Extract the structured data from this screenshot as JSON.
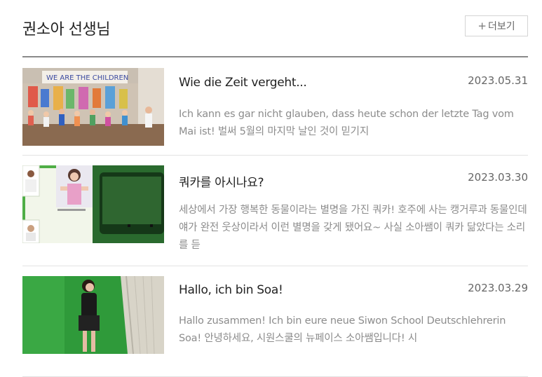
{
  "header": {
    "title": "권소아 선생님",
    "more_plus": "+",
    "more_label": "더보기"
  },
  "posts": [
    {
      "title": "Wie die Zeit vergeht...",
      "date": "2023.05.31",
      "excerpt": "Ich kann es gar nicht glauben, dass heute schon der letzte Tag vom Mai ist! 벌써 5월의 마지막 날인 것이 믿기지",
      "thumb_banner": "WE ARE THE CHILDREN"
    },
    {
      "title": "쿼카를 아시나요?",
      "date": "2023.03.30",
      "excerpt": "세상에서 가장 행복한 동물이라는 별명을 가진 쿼카! 호주에 사는 캥거루과 동물인데 얘가 완전 웃상이라서 이런 별명을 갖게 됐어요~ 사실 소아쌤이 쿼카 닮았다는 소리를 듣"
    },
    {
      "title": "Hallo, ich bin Soa!",
      "date": "2023.03.29",
      "excerpt": "Hallo zusammen! Ich bin eure neue Siwon School Deutschlehrerin Soa! 안녕하세요, 시원스쿨의 뉴페이스 소아쌤입니다! 시"
    }
  ]
}
